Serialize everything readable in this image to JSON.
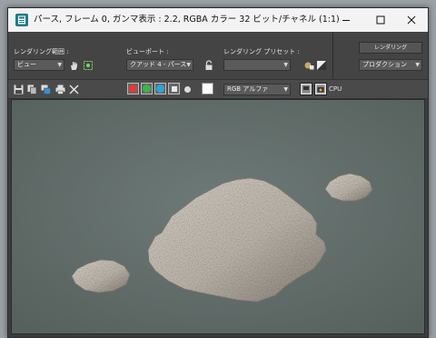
{
  "window": {
    "title": "パース, フレーム 0, ガンマ表示 : 2.2, RGBA カラー 32 ビット/チャネル (1:1)",
    "minimize_icon": "minimize-icon",
    "maximize_icon": "maximize-icon",
    "close_icon": "close-icon"
  },
  "controls": {
    "area_label": "レンダリング範囲 :",
    "area_value": "ビュー",
    "viewport_label": "ビューポート :",
    "viewport_value": "クアッド 4 - パース",
    "preset_label": "レンダリング プリセット :",
    "preset_value": "",
    "render_button": "レンダリング",
    "production_value": "プロダクション"
  },
  "toolbar": {
    "channel_value": "RGB アルファ",
    "cpu_label": "CPU"
  },
  "colors": {
    "accent_red": "#e23a3a",
    "accent_green": "#3bb54a",
    "accent_blue": "#2aa6d6"
  }
}
